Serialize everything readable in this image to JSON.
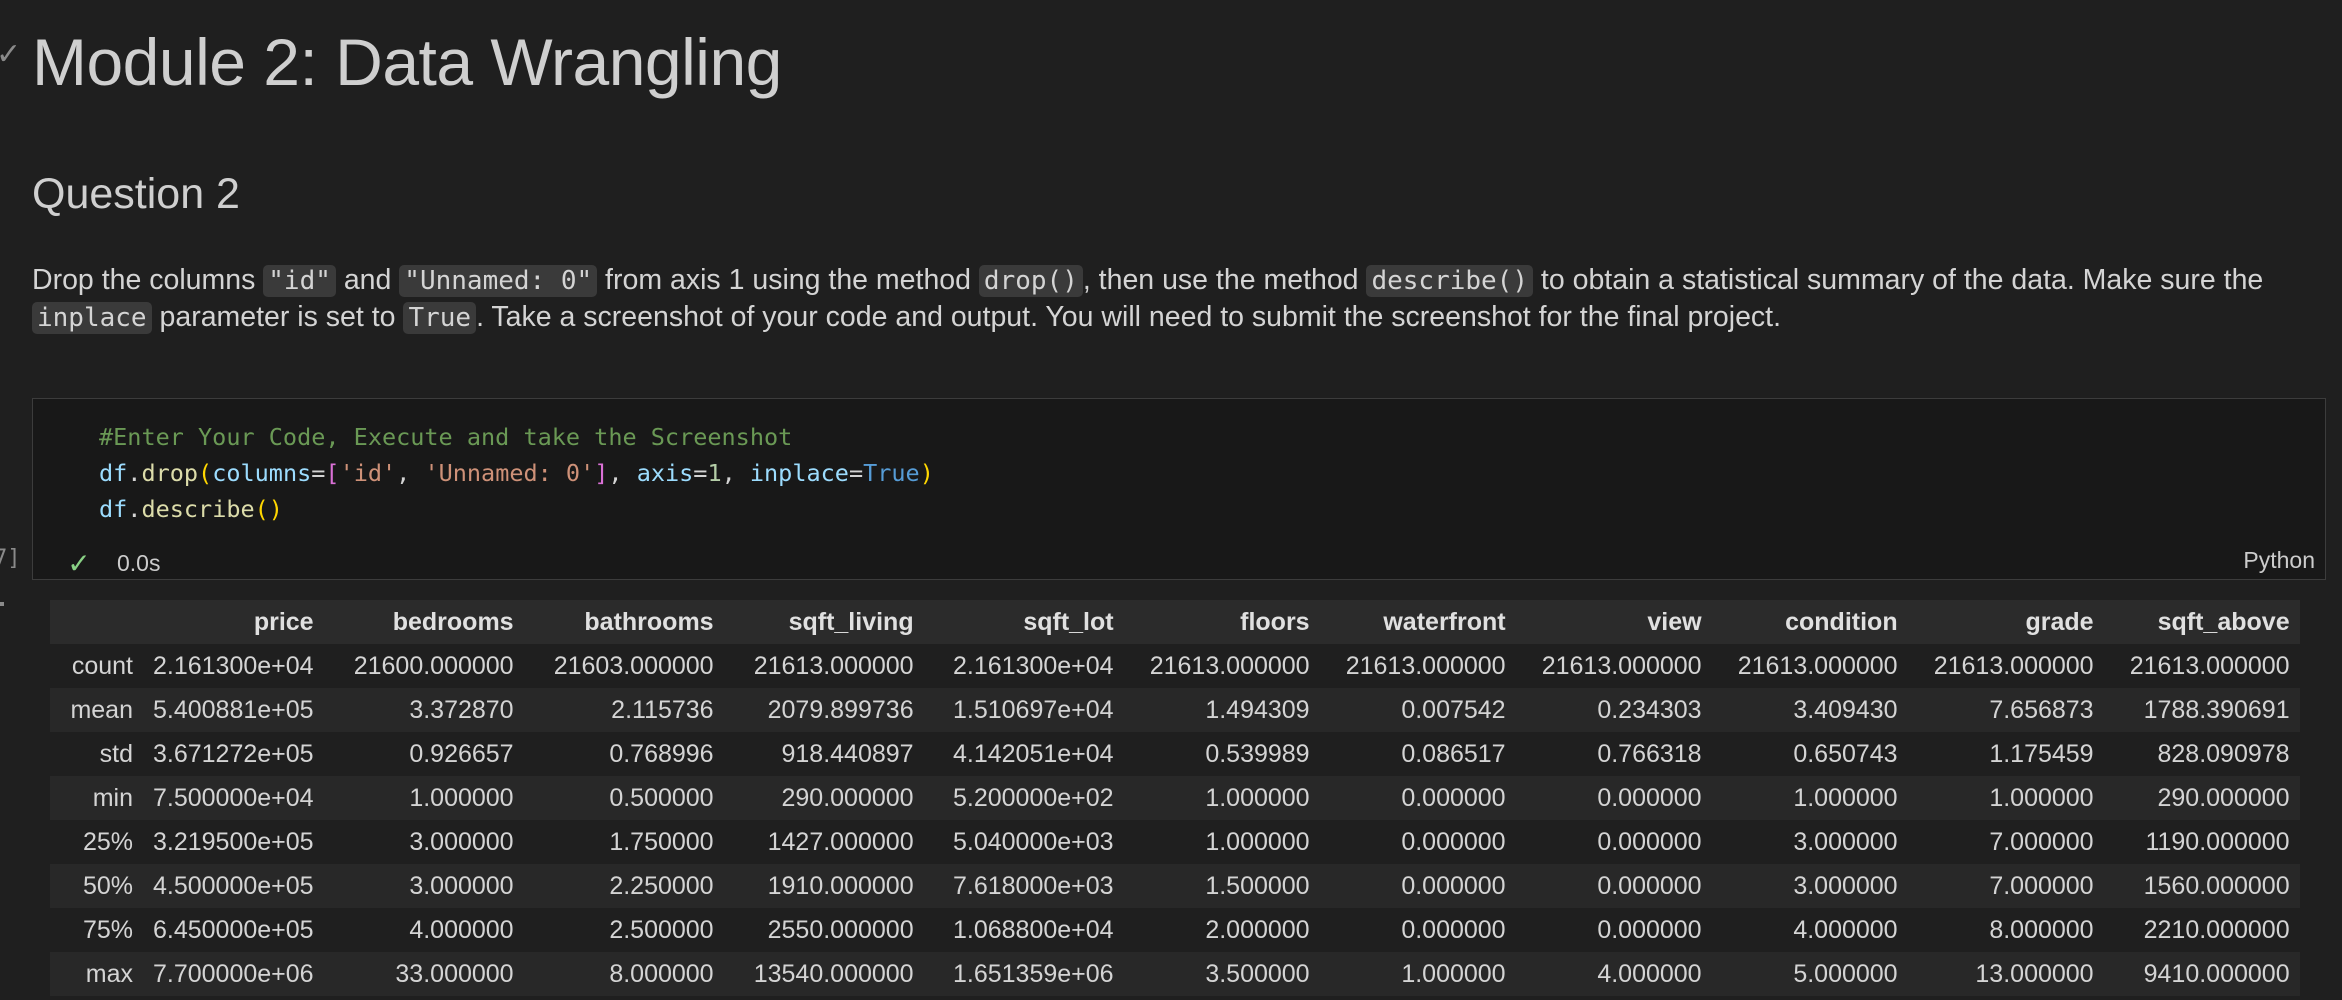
{
  "notebook": {
    "h1": "Module 2: Data Wrangling",
    "h2": "Question 2",
    "paragraph": {
      "p1": "Drop the columns ",
      "c1": "\"id\"",
      "p2": " and ",
      "c2": "\"Unnamed: 0\"",
      "p3": " from axis 1 using the method ",
      "c3": "drop()",
      "p4": ", then use the method ",
      "c4": "describe()",
      "p5": " to obtain a statistical summary of the data. Make sure the ",
      "c5": "inplace",
      "p6": " parameter is set to ",
      "c6": "True",
      "p7": ". Take a screenshot of your code and output. You will need to submit the screenshot for the final project."
    }
  },
  "code_cell": {
    "line1": "#Enter Your Code, Execute and take the Screenshot",
    "line2": {
      "df": "df",
      "dot": ".",
      "drop": "drop",
      "open": "(",
      "columns": "columns",
      "eq": "=",
      "lbr": "[",
      "s1": "'id'",
      "comma1": ", ",
      "s2": "'Unnamed: 0'",
      "rbr": "]",
      "comma2": ", ",
      "axis": "axis",
      "eq2": "=",
      "one": "1",
      "comma3": ", ",
      "inplace": "inplace",
      "eq3": "=",
      "true": "True",
      "close": ")"
    },
    "line3": {
      "df": "df",
      "dot": ".",
      "describe": "describe",
      "parens": "()"
    },
    "status_icon": "check-icon",
    "status_time": "0.0s",
    "language": "Python",
    "execution_count": "7]"
  },
  "output_table": {
    "columns": [
      "",
      "price",
      "bedrooms",
      "bathrooms",
      "sqft_living",
      "sqft_lot",
      "floors",
      "waterfront",
      "view",
      "condition",
      "grade",
      "sqft_above"
    ],
    "rows": [
      [
        "count",
        "2.161300e+04",
        "21600.000000",
        "21603.000000",
        "21613.000000",
        "2.161300e+04",
        "21613.000000",
        "21613.000000",
        "21613.000000",
        "21613.000000",
        "21613.000000",
        "21613.000000"
      ],
      [
        "mean",
        "5.400881e+05",
        "3.372870",
        "2.115736",
        "2079.899736",
        "1.510697e+04",
        "1.494309",
        "0.007542",
        "0.234303",
        "3.409430",
        "7.656873",
        "1788.390691"
      ],
      [
        "std",
        "3.671272e+05",
        "0.926657",
        "0.768996",
        "918.440897",
        "4.142051e+04",
        "0.539989",
        "0.086517",
        "0.766318",
        "0.650743",
        "1.175459",
        "828.090978"
      ],
      [
        "min",
        "7.500000e+04",
        "1.000000",
        "0.500000",
        "290.000000",
        "5.200000e+02",
        "1.000000",
        "0.000000",
        "0.000000",
        "1.000000",
        "1.000000",
        "290.000000"
      ],
      [
        "25%",
        "3.219500e+05",
        "3.000000",
        "1.750000",
        "1427.000000",
        "5.040000e+03",
        "1.000000",
        "0.000000",
        "0.000000",
        "3.000000",
        "7.000000",
        "1190.000000"
      ],
      [
        "50%",
        "4.500000e+05",
        "3.000000",
        "2.250000",
        "1910.000000",
        "7.618000e+03",
        "1.500000",
        "0.000000",
        "0.000000",
        "3.000000",
        "7.000000",
        "1560.000000"
      ],
      [
        "75%",
        "6.450000e+05",
        "4.000000",
        "2.500000",
        "2550.000000",
        "1.068800e+04",
        "2.000000",
        "0.000000",
        "0.000000",
        "4.000000",
        "8.000000",
        "2210.000000"
      ],
      [
        "max",
        "7.700000e+06",
        "33.000000",
        "8.000000",
        "13540.000000",
        "1.651359e+06",
        "3.500000",
        "1.000000",
        "4.000000",
        "5.000000",
        "13.000000",
        "9410.000000"
      ]
    ]
  }
}
